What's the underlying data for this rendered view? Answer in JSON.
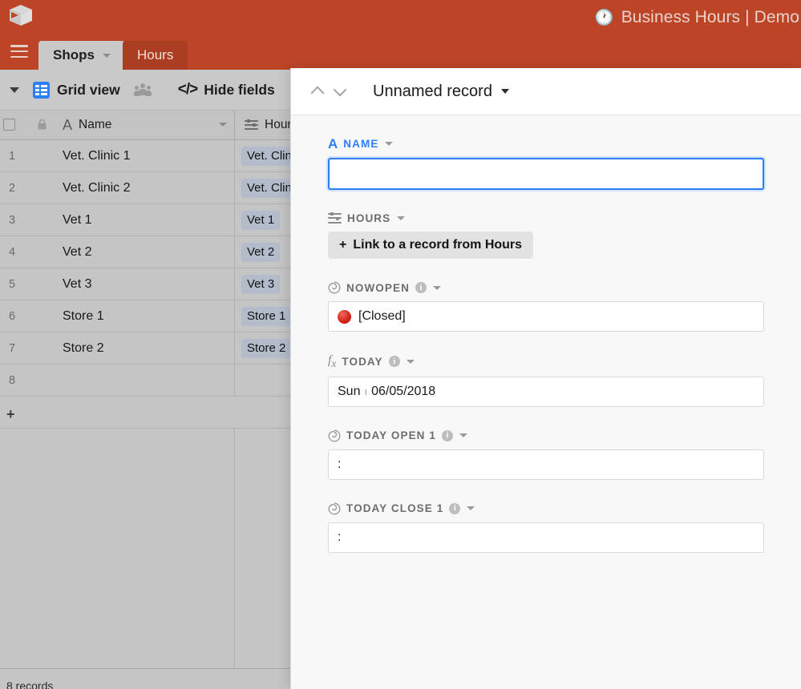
{
  "brand": {
    "title": "Business Hours | Demo",
    "clock_icon": "clock-icon",
    "logo_icon": "airtable-cube-logo"
  },
  "tabs": {
    "menu_icon": "hamburger-menu-icon",
    "items": [
      {
        "label": "Shops",
        "active": true
      },
      {
        "label": "Hours",
        "active": false
      }
    ],
    "add_label": "+"
  },
  "toolbar": {
    "view_name": "Grid view",
    "collaborators_icon": "people-icon",
    "hide_fields_label": "Hide fields",
    "hide_fields_icon": "code-brackets-icon"
  },
  "grid": {
    "columns": [
      {
        "key": "num",
        "label": ""
      },
      {
        "key": "name",
        "label": "Name",
        "type_icon": "text-type-A-icon"
      },
      {
        "key": "hours",
        "label": "Hour",
        "type_icon": "linked-record-icon"
      }
    ],
    "rows": [
      {
        "num": "1",
        "name": "Vet. Clinic 1",
        "hours": "Vet. Clin"
      },
      {
        "num": "2",
        "name": "Vet. Clinic 2",
        "hours": "Vet. Clin"
      },
      {
        "num": "3",
        "name": "Vet 1",
        "hours": "Vet 1"
      },
      {
        "num": "4",
        "name": "Vet 2",
        "hours": "Vet 2"
      },
      {
        "num": "5",
        "name": "Vet 3",
        "hours": "Vet 3"
      },
      {
        "num": "6",
        "name": "Store 1",
        "hours": "Store 1"
      },
      {
        "num": "7",
        "name": "Store 2",
        "hours": "Store 2"
      },
      {
        "num": "8",
        "name": "",
        "hours": ""
      }
    ],
    "add_row_label": "+",
    "footer_label": "8 records"
  },
  "record_panel": {
    "title": "Unnamed record",
    "prev_icon": "chevron-up-icon",
    "next_icon": "chevron-down-icon",
    "menu_icon": "caret-down-icon",
    "fields": [
      {
        "label": "NAME",
        "icon": "text-type-A-icon",
        "has_info": false,
        "value": "",
        "focused": true
      },
      {
        "label": "HOURS",
        "icon": "linked-record-icon",
        "has_info": false,
        "button_label": "Link to a record from Hours"
      },
      {
        "label": "NOWOPEN",
        "icon": "rollup-spiral-icon",
        "has_info": true,
        "value": "[Closed]",
        "status_dot": "red-circle-icon",
        "status_color": "#d42018"
      },
      {
        "label": "TODAY",
        "icon": "formula-fx-icon",
        "has_info": true,
        "value_day": "Sun",
        "value_date": "06/05/2018"
      },
      {
        "label": "TODAY OPEN 1",
        "icon": "rollup-spiral-icon",
        "has_info": true,
        "value": ":"
      },
      {
        "label": "TODAY CLOSE 1",
        "icon": "rollup-spiral-icon",
        "has_info": true,
        "value": ":"
      }
    ]
  },
  "colors": {
    "brand_red": "#bd4527",
    "tab_inactive": "#ab3d22",
    "accent_blue": "#2d7ff9",
    "chip_blue": "#b4bccb",
    "panel_bg": "#f8f8f8"
  }
}
